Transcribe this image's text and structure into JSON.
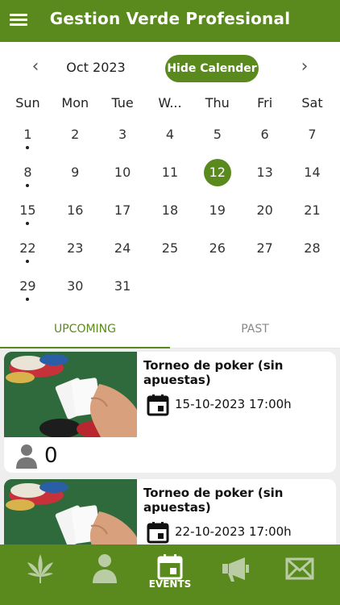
{
  "header": {
    "title": "Gestion Verde Profesional"
  },
  "calendar": {
    "month_label": "Oct 2023",
    "toggle_label": "Hide Calender",
    "weekdays": [
      "Sun",
      "Mon",
      "Tue",
      "W...",
      "Thu",
      "Fri",
      "Sat"
    ],
    "selected_day": "12",
    "weeks": [
      [
        {
          "d": "1",
          "dot": true
        },
        {
          "d": "2"
        },
        {
          "d": "3"
        },
        {
          "d": "4"
        },
        {
          "d": "5"
        },
        {
          "d": "6"
        },
        {
          "d": "7"
        }
      ],
      [
        {
          "d": "8",
          "dot": true
        },
        {
          "d": "9"
        },
        {
          "d": "10"
        },
        {
          "d": "11"
        },
        {
          "d": "12"
        },
        {
          "d": "13"
        },
        {
          "d": "14"
        }
      ],
      [
        {
          "d": "15",
          "dot": true
        },
        {
          "d": "16"
        },
        {
          "d": "17"
        },
        {
          "d": "18"
        },
        {
          "d": "19"
        },
        {
          "d": "20"
        },
        {
          "d": "21"
        }
      ],
      [
        {
          "d": "22",
          "dot": true
        },
        {
          "d": "23"
        },
        {
          "d": "24"
        },
        {
          "d": "25"
        },
        {
          "d": "26"
        },
        {
          "d": "27"
        },
        {
          "d": "28"
        }
      ],
      [
        {
          "d": "29",
          "dot": true
        },
        {
          "d": "30"
        },
        {
          "d": "31"
        }
      ]
    ]
  },
  "tabs": {
    "upcoming": "UPCOMING",
    "past": "PAST"
  },
  "events": [
    {
      "title": "Torneo de poker (sin apuestas)",
      "datetime": "15-10-2023 17:00h",
      "attendees": "0",
      "image": "poker-chips-cards"
    },
    {
      "title": "Torneo de poker (sin apuestas)",
      "datetime": "22-10-2023 17:00h",
      "image": "poker-chips-cards"
    }
  ],
  "bottom_nav": {
    "events_label": "EVENTS"
  },
  "colors": {
    "brand": "#5a8a1e"
  }
}
